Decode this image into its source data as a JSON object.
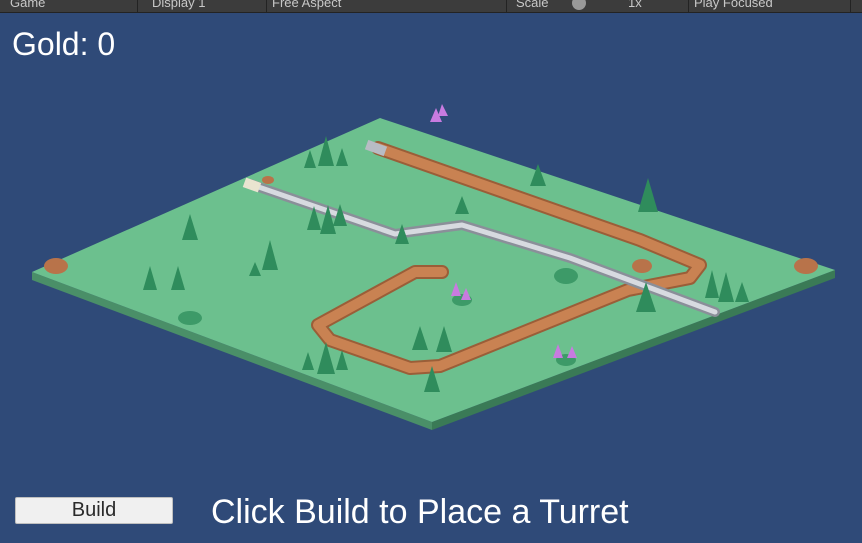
{
  "toolbar": {
    "game_tab": "Game",
    "display": "Display 1",
    "aspect": "Free Aspect",
    "scale_label": "Scale",
    "scale_value": "1x",
    "play_mode": "Play Focused"
  },
  "hud": {
    "gold_label": "Gold: 0"
  },
  "build_button": {
    "label": "Build"
  },
  "hint": {
    "text": "Click Build to Place a Turret"
  },
  "colors": {
    "background": "#2f4a78",
    "grass": "#6cc08e",
    "path": "#c98252",
    "tree": "#2f8c5c",
    "crystal": "#c87be0"
  }
}
